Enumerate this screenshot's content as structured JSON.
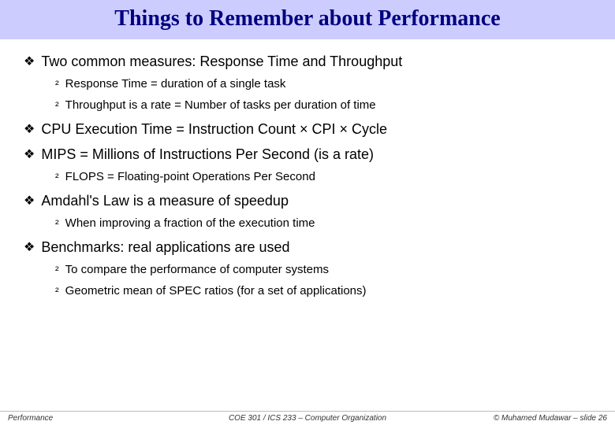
{
  "title": "Things to Remember about Performance",
  "bullets": [
    {
      "text": "Two common measures: Response Time and Throughput",
      "sub": [
        "Response Time = duration of a single task",
        "Throughput is a rate = Number of tasks per duration of time"
      ]
    },
    {
      "text": "CPU Execution Time = Instruction Count × CPI × Cycle",
      "sub": []
    },
    {
      "text": "MIPS = Millions of Instructions Per Second (is a rate)",
      "sub": [
        "FLOPS = Floating-point Operations Per Second"
      ]
    },
    {
      "text": "Amdahl's Law is a measure of speedup",
      "sub": [
        "When improving a fraction of the execution time"
      ]
    },
    {
      "text": "Benchmarks: real applications are used",
      "sub": [
        "To compare the performance of computer systems",
        "Geometric mean of SPEC ratios (for a set of applications)"
      ]
    }
  ],
  "footer": {
    "left": "Performance",
    "center": "COE 301 / ICS 233 – Computer Organization",
    "right": "© Muhamed Mudawar – slide 26"
  },
  "markers": {
    "level1": "❖",
    "level2": "²"
  }
}
